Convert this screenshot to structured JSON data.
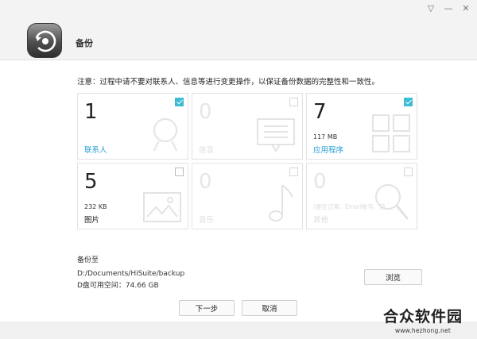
{
  "window_controls": {
    "menu": "▽",
    "minimize": "—",
    "close": "✕"
  },
  "app": {
    "title": "备份",
    "icon": "backup-restore-icon"
  },
  "notice": "注意：过程中请不要对联系人、信息等进行变更操作，以保证备份数据的完整性和一致性。",
  "items": [
    {
      "key": "contacts",
      "count": "1",
      "label": "联系人",
      "size": "",
      "checked": true,
      "enabled": true,
      "icon": "contact-person-icon"
    },
    {
      "key": "messages",
      "count": "0",
      "label": "信息",
      "size": "",
      "checked": false,
      "enabled": false,
      "icon": "message-icon"
    },
    {
      "key": "apps",
      "count": "7",
      "label": "应用程序",
      "size": "117 MB",
      "checked": true,
      "enabled": true,
      "icon": "apps-grid-icon"
    },
    {
      "key": "pictures",
      "count": "5",
      "label": "图片",
      "size": "232 KB",
      "checked": false,
      "enabled": true,
      "icon": "picture-icon"
    },
    {
      "key": "music",
      "count": "0",
      "label": "音乐",
      "size": "",
      "checked": false,
      "enabled": false,
      "icon": "music-note-icon"
    },
    {
      "key": "other",
      "count": "0",
      "label": "其他",
      "size": "",
      "checked": false,
      "enabled": false,
      "icon": "search-icon",
      "sublabels": [
        "(便签记事、",
        "Email帐号、日"
      ]
    }
  ],
  "backup": {
    "label": "备份至",
    "path": "D:/Documents/HiSuite/backup",
    "space": "D盘可用空间：74.66 GB",
    "browse_label": "浏览"
  },
  "buttons": {
    "next": "下一步",
    "cancel": "取消"
  },
  "watermark": {
    "title": "合众软件园",
    "url": "www.hezhong.net"
  },
  "colors": {
    "accent": "#2a9fd6",
    "check": "#3dbcd3"
  }
}
